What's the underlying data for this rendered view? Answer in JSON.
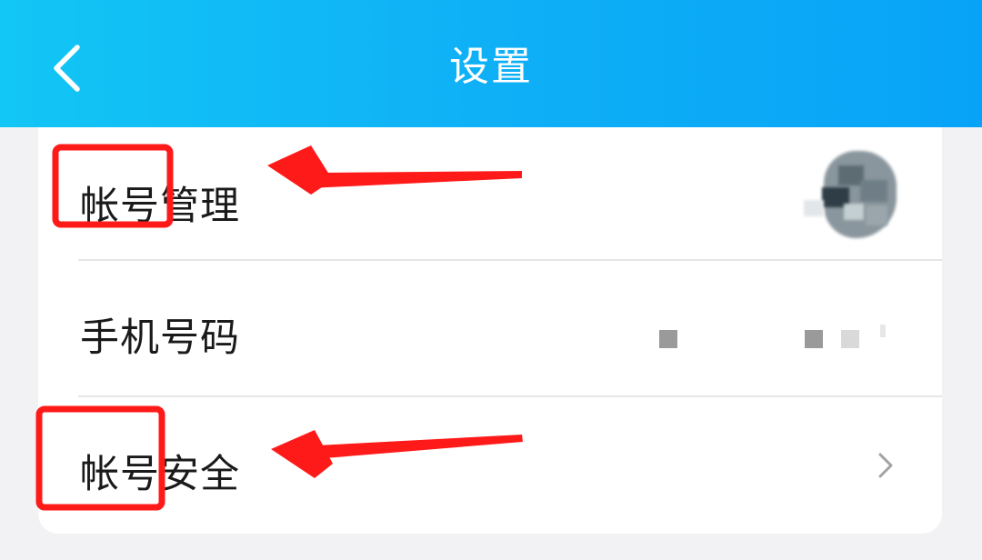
{
  "header": {
    "title": "设置",
    "back_icon": "chevron-left-icon",
    "gradient": [
      "#12c6f5",
      "#08a3f7"
    ],
    "title_color": "#ffffff"
  },
  "settings": {
    "rows": [
      {
        "label": "帐号管理",
        "trailing": "avatar"
      },
      {
        "label": "手机号码",
        "trailing": "redacted-number"
      },
      {
        "label": "帐号安全",
        "trailing": "chevron-right-icon"
      }
    ]
  },
  "annotations": {
    "color": "#ff1a1a",
    "highlight_boxes": [
      "帐号",
      "帐号"
    ],
    "arrows": [
      "arrow-to-account-management",
      "arrow-to-account-security"
    ]
  }
}
